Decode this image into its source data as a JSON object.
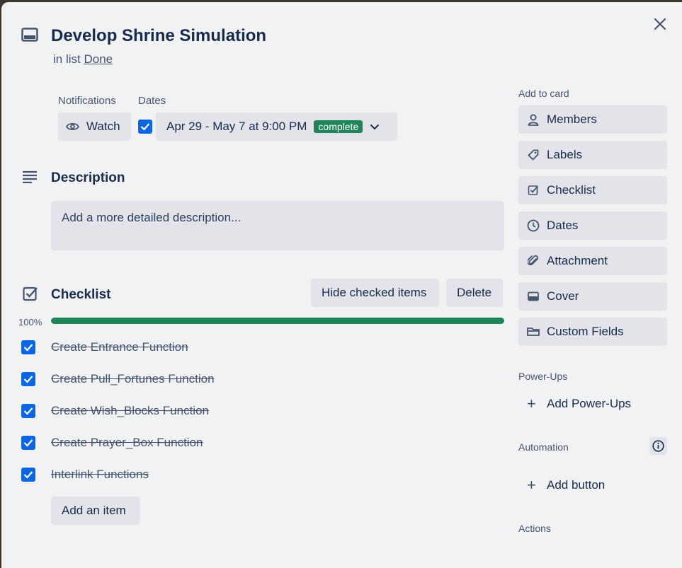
{
  "card": {
    "title": "Develop Shrine Simulation",
    "in_list_prefix": "in list",
    "list_name": "Done"
  },
  "notifications": {
    "label": "Notifications",
    "watch_label": "Watch"
  },
  "dates": {
    "label": "Dates",
    "value": "Apr 29 - May 7 at 9:00 PM",
    "status_badge": "complete"
  },
  "description": {
    "title": "Description",
    "placeholder": "Add a more detailed description..."
  },
  "checklist": {
    "title": "Checklist",
    "hide_checked_label": "Hide checked items",
    "delete_label": "Delete",
    "progress_text": "100%",
    "progress": 1.0,
    "items": [
      {
        "text": "Create Entrance Function",
        "checked": true
      },
      {
        "text": "Create Pull_Fortunes Function",
        "checked": true
      },
      {
        "text": "Create Wish_Blocks Function",
        "checked": true
      },
      {
        "text": "Create Prayer_Box Function",
        "checked": true
      },
      {
        "text": "Interlink Functions",
        "checked": true
      }
    ],
    "add_item_label": "Add an item"
  },
  "sidebar": {
    "add_to_card_label": "Add to card",
    "buttons": [
      {
        "label": "Members",
        "icon": "person-icon"
      },
      {
        "label": "Labels",
        "icon": "tag-icon"
      },
      {
        "label": "Checklist",
        "icon": "checklist-icon"
      },
      {
        "label": "Dates",
        "icon": "clock-icon"
      },
      {
        "label": "Attachment",
        "icon": "paperclip-icon"
      },
      {
        "label": "Cover",
        "icon": "cover-icon"
      },
      {
        "label": "Custom Fields",
        "icon": "custom-fields-icon"
      }
    ],
    "power_ups_label": "Power-Ups",
    "add_power_ups_label": "Add Power-Ups",
    "automation_label": "Automation",
    "add_button_label": "Add button",
    "actions_label": "Actions"
  },
  "colors": {
    "accent_blue": "#0c66e4",
    "complete_green": "#1f845a",
    "modal_bg": "#f1f2f4",
    "button_bg": "#e2e4e9"
  }
}
